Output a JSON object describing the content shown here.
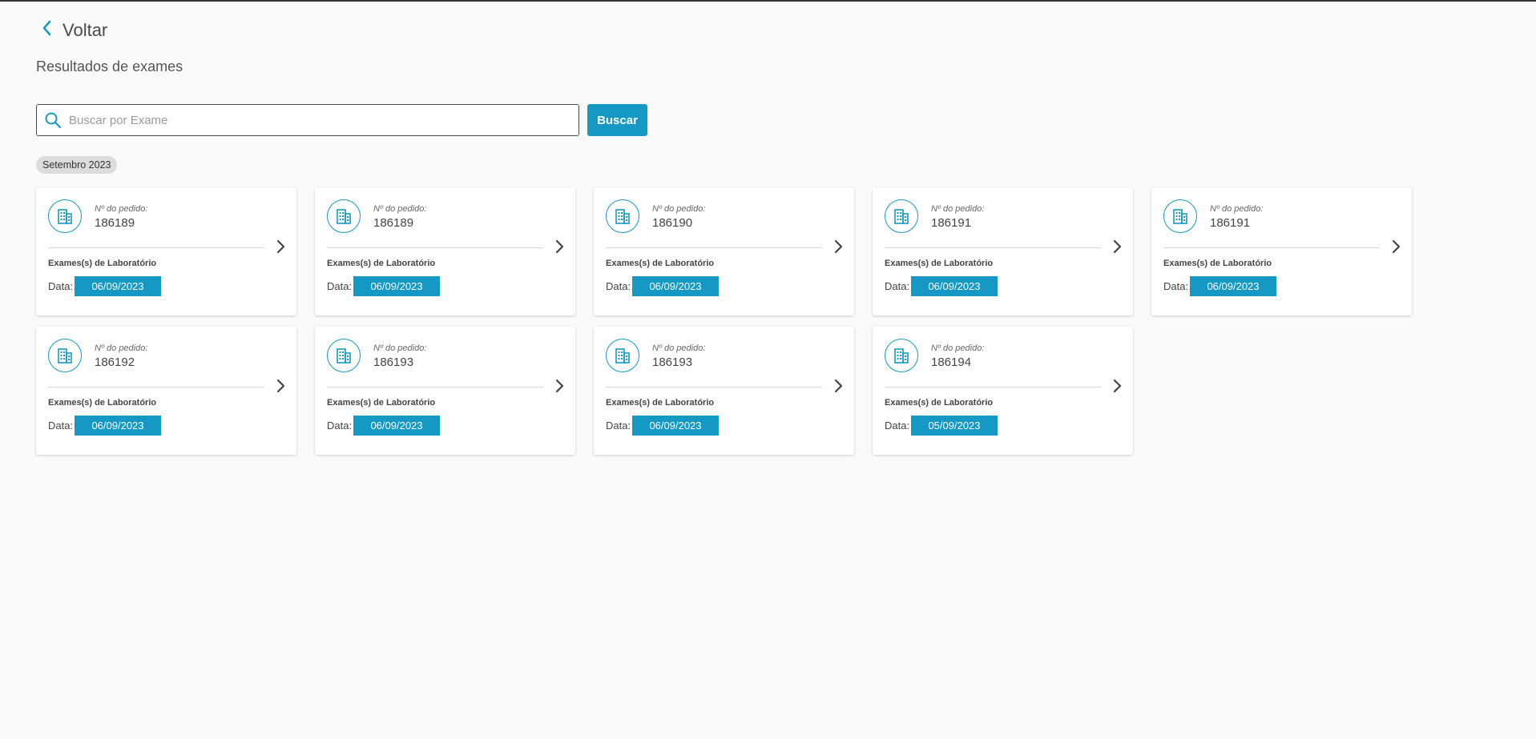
{
  "header": {
    "back_label": "Voltar",
    "title": "Resultados de exames"
  },
  "search": {
    "placeholder": "Buscar por Exame",
    "button_label": "Buscar"
  },
  "month_chip": "Setembro 2023",
  "colors": {
    "accent": "#1599c4"
  },
  "cards": [
    {
      "order_label": "Nº do pedido:",
      "order_number": "186189",
      "exam_type": "Exames(s) de Laboratório",
      "date_label": "Data:",
      "date": "06/09/2023"
    },
    {
      "order_label": "Nº do pedido:",
      "order_number": "186189",
      "exam_type": "Exames(s) de Laboratório",
      "date_label": "Data:",
      "date": "06/09/2023"
    },
    {
      "order_label": "Nº do pedido:",
      "order_number": "186190",
      "exam_type": "Exames(s) de Laboratório",
      "date_label": "Data:",
      "date": "06/09/2023"
    },
    {
      "order_label": "Nº do pedido:",
      "order_number": "186191",
      "exam_type": "Exames(s) de Laboratório",
      "date_label": "Data:",
      "date": "06/09/2023"
    },
    {
      "order_label": "Nº do pedido:",
      "order_number": "186191",
      "exam_type": "Exames(s) de Laboratório",
      "date_label": "Data:",
      "date": "06/09/2023"
    },
    {
      "order_label": "Nº do pedido:",
      "order_number": "186192",
      "exam_type": "Exames(s) de Laboratório",
      "date_label": "Data:",
      "date": "06/09/2023"
    },
    {
      "order_label": "Nº do pedido:",
      "order_number": "186193",
      "exam_type": "Exames(s) de Laboratório",
      "date_label": "Data:",
      "date": "06/09/2023"
    },
    {
      "order_label": "Nº do pedido:",
      "order_number": "186193",
      "exam_type": "Exames(s) de Laboratório",
      "date_label": "Data:",
      "date": "06/09/2023"
    },
    {
      "order_label": "Nº do pedido:",
      "order_number": "186194",
      "exam_type": "Exames(s) de Laboratório",
      "date_label": "Data:",
      "date": "05/09/2023"
    }
  ]
}
